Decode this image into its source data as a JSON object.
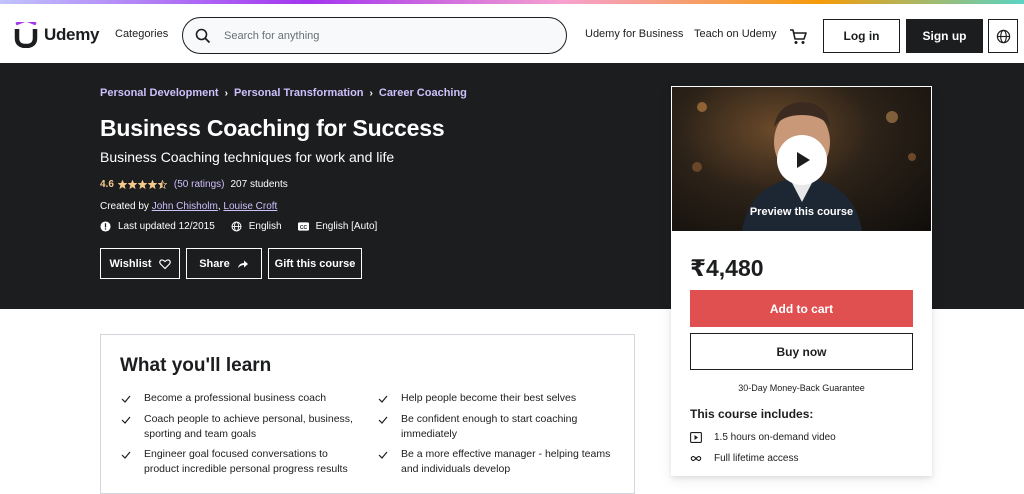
{
  "colors": {
    "accent": "#1c1d1f",
    "breadcrumb": "#cec0fc",
    "rating": "#f3ca8c",
    "cart_button": "#e05050",
    "banner": "#1c1d1f"
  },
  "header": {
    "logo_text": "Udemy",
    "categories": "Categories",
    "search_placeholder": "Search for anything",
    "udemy_business": "Udemy for Business",
    "teach": "Teach on Udemy",
    "login": "Log in",
    "signup": "Sign up",
    "icons": [
      "search-icon",
      "cart-icon",
      "globe-icon"
    ]
  },
  "banner": {
    "breadcrumbs": [
      "Personal Development",
      "Personal Transformation",
      "Career Coaching"
    ],
    "title": "Business Coaching for Success",
    "subtitle": "Business Coaching techniques for work and life",
    "rating": "4.6",
    "stars": 4.5,
    "rating_count": "(50 ratings)",
    "students": "207 students",
    "created_by_label": "Created by",
    "instructors": [
      "John Chisholm",
      "Louise Croft"
    ],
    "instructor_sep": ",",
    "last_updated": "Last updated 12/2015",
    "language": "English",
    "captions": "English [Auto]",
    "wishlist": "Wishlist",
    "share": "Share",
    "gift": "Gift this course"
  },
  "card": {
    "preview_label": "Preview this course",
    "price": "₹4,480",
    "add_to_cart": "Add to cart",
    "buy_now": "Buy now",
    "guarantee": "30-Day Money-Back Guarantee",
    "includes_title": "This course includes:",
    "includes": [
      "1.5 hours on-demand video",
      "Full lifetime access"
    ]
  },
  "learn": {
    "title": "What you'll learn",
    "items": [
      "Become a professional business coach",
      "Help people become their best selves",
      "Coach people to achieve personal, business, sporting and team goals",
      "Be confident enough to start coaching immediately",
      "Engineer goal focused conversations to product incredible personal progress results",
      "Be a more effective manager - helping teams and individuals develop"
    ]
  }
}
